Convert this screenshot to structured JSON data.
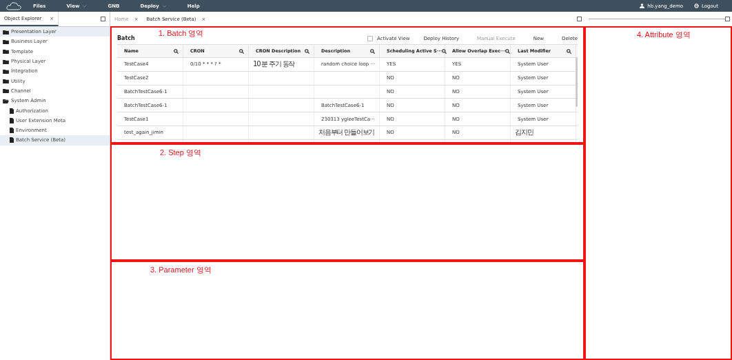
{
  "top_bar": {
    "menus": [
      {
        "label": "Files",
        "dropdown": false
      },
      {
        "label": "View",
        "dropdown": true
      },
      {
        "label": "GNB",
        "dropdown": false
      },
      {
        "label": "Deploy",
        "dropdown": true
      },
      {
        "label": "Help",
        "dropdown": false
      }
    ],
    "user": "hb.yang_demo",
    "logout": "Logout"
  },
  "explorer": {
    "tab": "Object Explorer",
    "close": "×",
    "items": [
      {
        "label": "Presentation Layer",
        "kind": "folder",
        "selected": true,
        "expanded": false
      },
      {
        "label": "Business Layer",
        "kind": "folder",
        "selected": false,
        "expanded": false
      },
      {
        "label": "Template",
        "kind": "folder",
        "selected": false,
        "expanded": false
      },
      {
        "label": "Physical Layer",
        "kind": "folder",
        "selected": false,
        "expanded": false
      },
      {
        "label": "Integration",
        "kind": "folder",
        "selected": false,
        "expanded": false
      },
      {
        "label": "Utility",
        "kind": "folder",
        "selected": false,
        "expanded": false
      },
      {
        "label": "Channel",
        "kind": "folder",
        "selected": false,
        "expanded": false
      },
      {
        "label": "System Admin",
        "kind": "folder",
        "selected": false,
        "expanded": true,
        "children": [
          {
            "label": "Authorization",
            "kind": "file",
            "selected": false
          },
          {
            "label": "User Extension Meta",
            "kind": "file",
            "selected": false
          },
          {
            "label": "Environment",
            "kind": "file",
            "selected": false
          },
          {
            "label": "Batch Service (Beta)",
            "kind": "file",
            "selected": true
          }
        ]
      }
    ]
  },
  "tabs": [
    {
      "label": "Home",
      "selected": false,
      "close": "×"
    },
    {
      "label": "Batch Service (Beta)",
      "selected": true,
      "close": "×"
    }
  ],
  "batch": {
    "annotation": "1. Batch 영역",
    "title": "Batch",
    "activate_view": {
      "label": "Activate View",
      "checked": false
    },
    "actions": [
      {
        "label": "Deploy History",
        "disabled": false
      },
      {
        "label": "Manual Execute",
        "disabled": true
      },
      {
        "label": "New",
        "disabled": false
      },
      {
        "label": "Delete",
        "disabled": false
      }
    ],
    "table": {
      "columns": [
        "Name",
        "CRON",
        "CRON Description",
        "Description",
        "Scheduling Active S···",
        "Allow Overlap Exec···",
        "Last Modifier"
      ],
      "rows": [
        [
          "TestCase4",
          "0/10 * * * ? *",
          "10 분 주기 동작",
          "random choice loop ···",
          "YES",
          "YES",
          "System User"
        ],
        [
          "TestCase2",
          "",
          "",
          "",
          "NO",
          "NO",
          "System User"
        ],
        [
          "BatchTestCase6-1",
          "",
          "",
          "",
          "NO",
          "NO",
          "System User"
        ],
        [
          "BatchTestCase6-1",
          "",
          "",
          "BatchTestCase6-1",
          "NO",
          "NO",
          "System User"
        ],
        [
          "TestCase1",
          "",
          "",
          "230313 ygleeTestCa···",
          "NO",
          "NO",
          "System User"
        ],
        [
          "test_again_jimin",
          "",
          "",
          "처음부터 만들어보기",
          "NO",
          "NO",
          "김지민"
        ]
      ]
    }
  },
  "step": {
    "annotation": "2. Step 영역"
  },
  "parameter": {
    "annotation": "3. Parameter 영역"
  },
  "attribute": {
    "annotation": "4. Attribute 영역"
  }
}
